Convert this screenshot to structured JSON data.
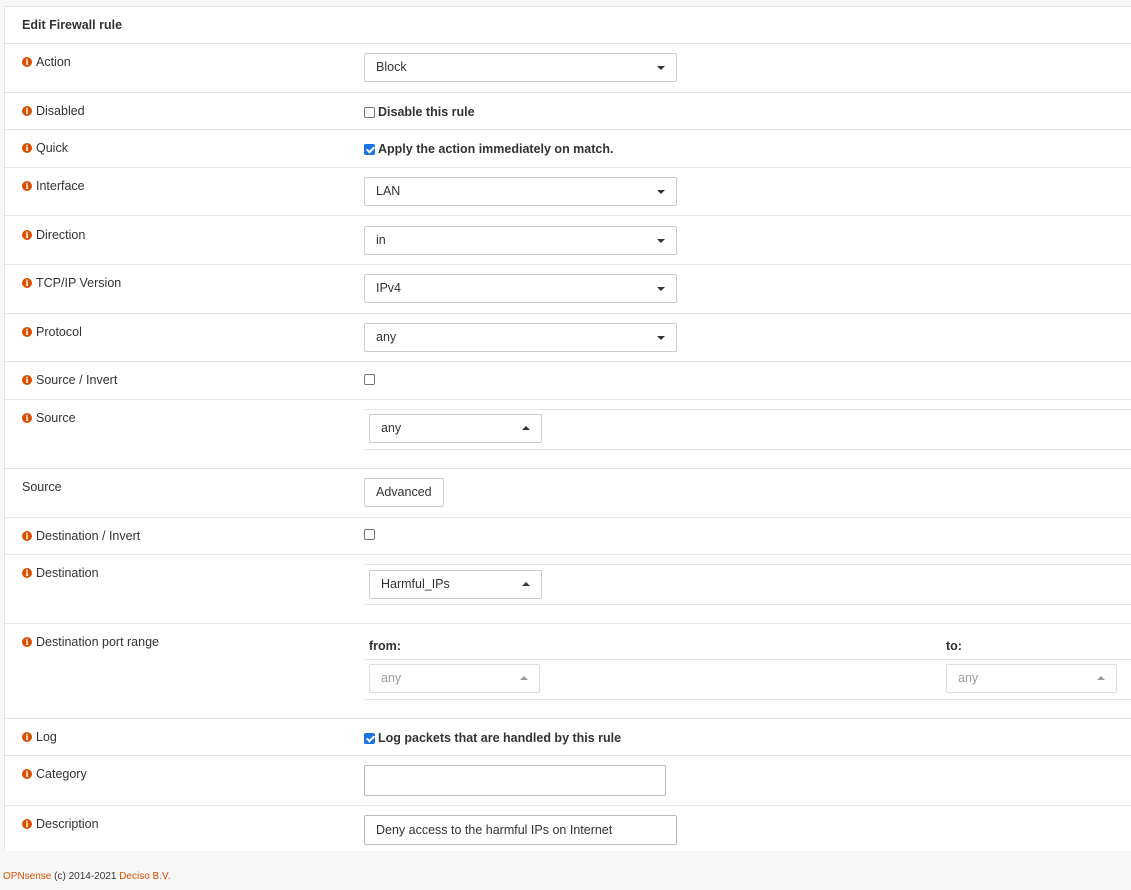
{
  "panel": {
    "title": "Edit Firewall rule"
  },
  "rows": {
    "action": {
      "label": "Action",
      "value": "Block"
    },
    "disabled": {
      "label": "Disabled",
      "checkbox_label": "Disable this rule",
      "checked": false
    },
    "quick": {
      "label": "Quick",
      "checkbox_label": "Apply the action immediately on match.",
      "checked": true
    },
    "interface": {
      "label": "Interface",
      "value": "LAN"
    },
    "direction": {
      "label": "Direction",
      "value": "in"
    },
    "tcpip": {
      "label": "TCP/IP Version",
      "value": "IPv4"
    },
    "protocol": {
      "label": "Protocol",
      "value": "any"
    },
    "source_invert": {
      "label": "Source / Invert",
      "checked": false
    },
    "source": {
      "label": "Source",
      "value": "any"
    },
    "source_advanced": {
      "label": "Source",
      "button": "Advanced"
    },
    "dest_invert": {
      "label": "Destination / Invert",
      "checked": false
    },
    "destination": {
      "label": "Destination",
      "value": "Harmful_IPs"
    },
    "dest_port": {
      "label": "Destination port range",
      "from_label": "from:",
      "to_label": "to:",
      "from_value": "any",
      "to_value": "any"
    },
    "log": {
      "label": "Log",
      "checkbox_label": "Log packets that are handled by this rule",
      "checked": true
    },
    "category": {
      "label": "Category",
      "value": ""
    },
    "description": {
      "label": "Description",
      "value": "Deny access to the harmful IPs on Internet"
    }
  },
  "footer": {
    "brand": "OPNsense",
    "copyright": "(c) 2014-2021",
    "company": "Deciso B.V."
  },
  "colors": {
    "info_icon": "#d94f00",
    "checkbox_checked": "#1a73e8",
    "footer_link": "#d94f00"
  }
}
